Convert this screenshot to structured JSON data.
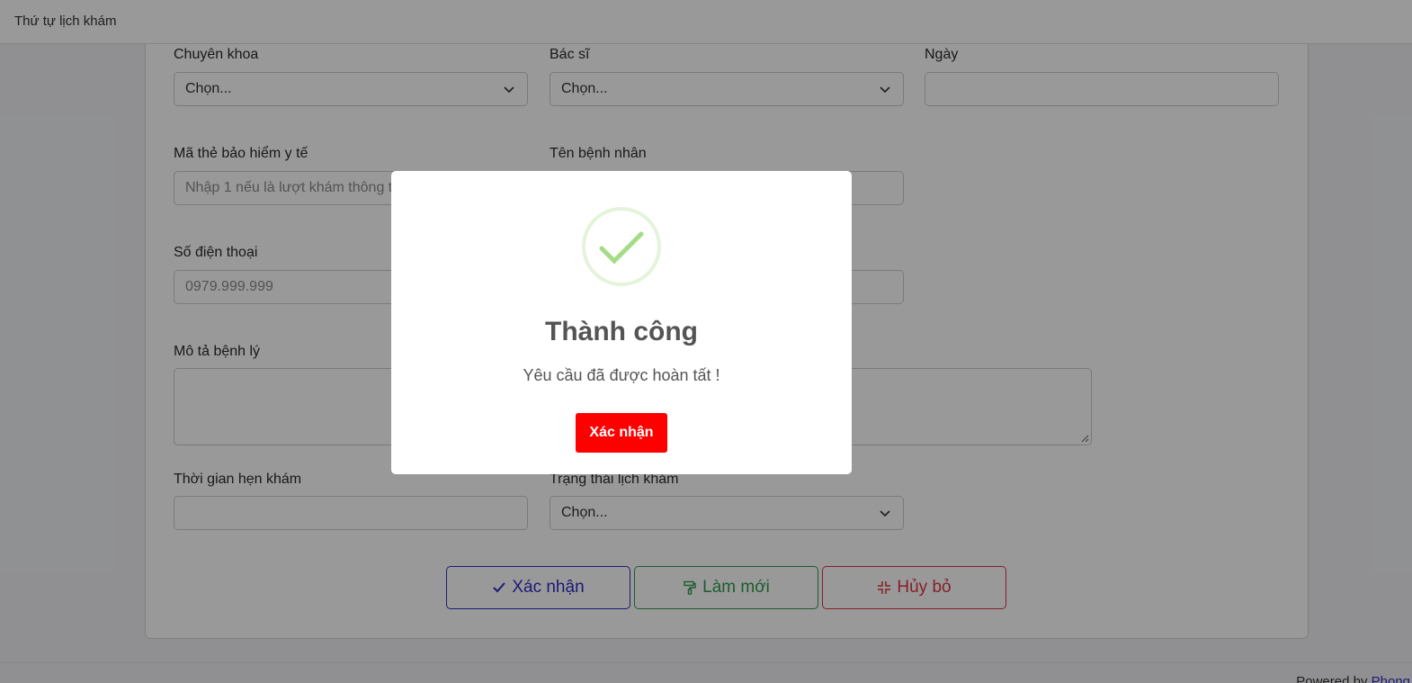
{
  "header": {
    "title": "Thứ tự lịch khám"
  },
  "form": {
    "specialty": {
      "label": "Chuyên khoa",
      "value": "Chọn..."
    },
    "doctor": {
      "label": "Bác sĩ",
      "value": "Chọn..."
    },
    "date": {
      "label": "Ngày",
      "value": ""
    },
    "insurance": {
      "label": "Mã thẻ bảo hiểm y tế",
      "placeholder": "Nhập 1 nếu là lượt khám thông t"
    },
    "patient_name": {
      "label": "Tên bệnh nhân",
      "value": ""
    },
    "phone": {
      "label": "Số điện thoại",
      "placeholder": "0979.999.999"
    },
    "description": {
      "label": "Mô tả bệnh lý",
      "value": ""
    },
    "appointment_time": {
      "label": "Thời gian hẹn khám",
      "value": ""
    },
    "status": {
      "label": "Trạng thái lịch khám",
      "value": "Chọn..."
    }
  },
  "actions": {
    "confirm_label": "Xác nhận",
    "refresh_label": "Làm mới",
    "cancel_label": "Hủy bỏ"
  },
  "footer": {
    "text": "Powered by ",
    "link": "Phong"
  },
  "modal": {
    "title": "Thành công",
    "message": "Yêu cầu đã được hoàn tất !",
    "button": "Xác nhận"
  },
  "colors": {
    "confirm": "#2d2dc8",
    "refresh": "#2f9b4b",
    "cancel": "#dc3545",
    "modal_button": "#ff0000",
    "success_check": "#a5dc86"
  }
}
